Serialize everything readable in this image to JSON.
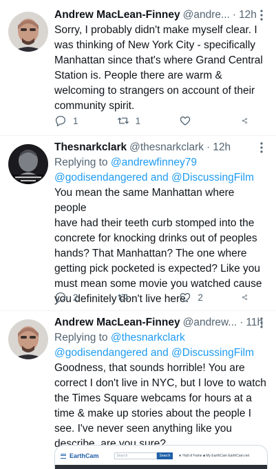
{
  "tweets": [
    {
      "name": "Andrew MacLean-Finney",
      "handle": "@andre...",
      "time": "12h",
      "reply_prefix": "",
      "reply_users": "",
      "reply_and": "",
      "reply_user2": "",
      "body": "Sorry, I probably didn't make myself clear. I\nwas thinking of New York City - specifically\nManhattan since that's where Grand Central\nStation is. People there are warm &\nwelcoming to strangers on account of their\ncommunity spirit.",
      "reply_count": "1",
      "retweet_count": "1",
      "like_count": ""
    },
    {
      "name": "Thesnarkclark",
      "handle": "@thesnarkclark",
      "time": "12h",
      "reply_prefix": "Replying to ",
      "reply_users": "@andrewfinney79",
      "reply_line2_user1": "@godisendangered",
      "reply_and": " and ",
      "reply_user2": "@DiscussingFilm",
      "body": "You mean the same Manhattan where people\nhave had their teeth curb stomped into the\nconcrete for knocking drinks out of peoples\nhands? That Manhattan? The one where\ngetting pick pocketed is expected? Like you\nmust mean some movie you watched cause\nyou definitely don't live here.",
      "reply_count": "2",
      "retweet_count": "",
      "like_count": "2"
    },
    {
      "name": "Andrew MacLean-Finney",
      "handle": "@andrew...",
      "time": "11h",
      "reply_prefix": "Replying to ",
      "reply_users": "@thesnarkclark",
      "reply_line2_user1": "@godisendangered",
      "reply_and": " and ",
      "reply_user2": "@DiscussingFilm",
      "body": "Goodness, that sounds horrible! You are\ncorrect I don't live in NYC, but I love to watch\nthe Times Square webcams for hours at a\ntime & make up stories about the people I\nsee. I've never seen anything like you\ndescribe, are you sure?"
    }
  ],
  "media": {
    "logo": "EarthCam",
    "search_placeholder": "Search",
    "search_button": "Search",
    "nav": "★ Hall of Fame   ■ My EarthCam   EarthCam.net"
  },
  "separator": "·",
  "icons": [
    "reply-icon",
    "retweet-icon",
    "like-icon",
    "share-icon",
    "more-icon"
  ],
  "colors": {
    "link": "#1d9bf0",
    "muted": "#536471",
    "text": "#0f1419"
  }
}
